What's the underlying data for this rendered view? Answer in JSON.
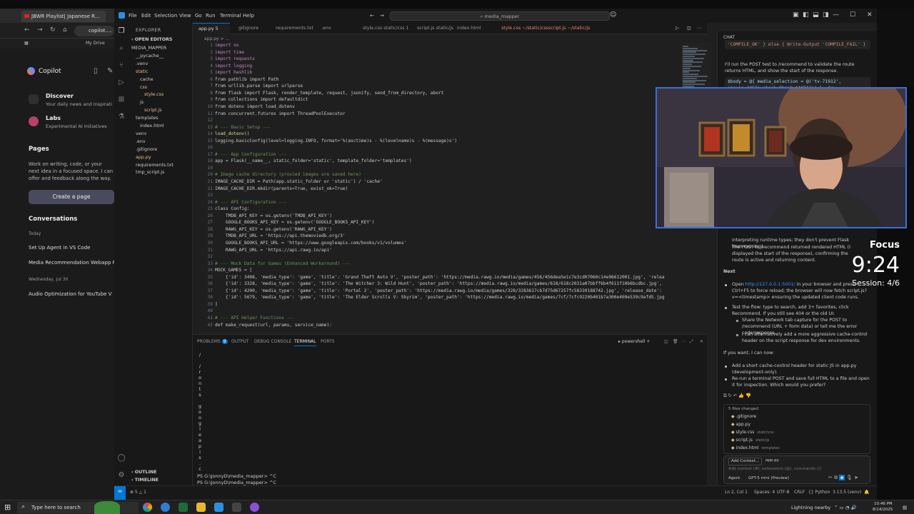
{
  "browser": {
    "tab_title": "JBWR Playlist| Japanese Rhythm",
    "url": "copilot.mic",
    "bookmark": "My Drive"
  },
  "copilot": {
    "brand": "Copilot",
    "discover": "Discover",
    "discover_sub": "Your daily news and inspirati",
    "labs": "Labs",
    "labs_sub": "Experimental AI Initiatives",
    "pages_head": "Pages",
    "pages_text": "Work on writing, code, or your next idea in a focused space. I can offer and feedback along the way.",
    "create_page": "Create a page",
    "conversations": "Conversations",
    "today": "Today",
    "conv1": "Set Up Agent in VS Code",
    "conv2": "Media Recommendation Webapp R",
    "date_head": "Wednesday, Jul 30",
    "conv3": "Audio Optimization for YouTube V"
  },
  "vscode": {
    "menus": [
      "File",
      "Edit",
      "Selection",
      "View",
      "Go",
      "Run",
      "Terminal",
      "Help"
    ],
    "search": "media_mapper",
    "explorer_title": "EXPLORER",
    "open_editors": "OPEN EDITORS",
    "tree": [
      {
        "label": "MEDIA_MAPPER",
        "indent": 0,
        "color": "#ccc"
      },
      {
        "label": "__pycache__",
        "indent": 1,
        "color": "#ccc"
      },
      {
        "label": ".venv",
        "indent": 1,
        "color": "#ccc"
      },
      {
        "label": "static",
        "indent": 1,
        "color": "#e2c08d"
      },
      {
        "label": "cache",
        "indent": 2,
        "color": "#ccc"
      },
      {
        "label": "css",
        "indent": 2,
        "color": "#e2c08d"
      },
      {
        "label": "style.css",
        "indent": 3,
        "color": "#e2c08d"
      },
      {
        "label": "js",
        "indent": 2,
        "color": "#ccc"
      },
      {
        "label": "script.js",
        "indent": 3,
        "color": "#e2c08d"
      },
      {
        "label": "templates",
        "indent": 1,
        "color": "#ccc"
      },
      {
        "label": "index.html",
        "indent": 2,
        "color": "#ccc"
      },
      {
        "label": "venv",
        "indent": 1,
        "color": "#ccc"
      },
      {
        "label": ".env",
        "indent": 1,
        "color": "#ccc"
      },
      {
        "label": ".gitignore",
        "indent": 1,
        "color": "#ccc"
      },
      {
        "label": "app.py",
        "indent": 1,
        "color": "#e2c08d"
      },
      {
        "label": "requirements.txt",
        "indent": 1,
        "color": "#ccc"
      },
      {
        "label": "tmp_script.js",
        "indent": 1,
        "color": "#ccc"
      }
    ],
    "outline": "OUTLINE",
    "timeline": "TIMELINE",
    "tabs": [
      "app.py 5",
      "gitignore",
      "requirements.txt",
      ".env",
      "style.css static/css 1",
      "script.js static/js",
      "index.html",
      "style.css ~/static/css",
      "script.js ~/static/js"
    ],
    "breadcrumb": "app.py > ...",
    "code_lines": [
      [
        "kw",
        "import os"
      ],
      [
        "kw",
        "import time"
      ],
      [
        "kw",
        "import requests"
      ],
      [
        "kw",
        "import logging"
      ],
      [
        "kw",
        "import hashlib"
      ],
      [
        "",
        "from pathlib import Path"
      ],
      [
        "",
        "from urllib.parse import urlparse"
      ],
      [
        "",
        "from flask import Flask, render_template, request, jsonify, send_from_directory, abort"
      ],
      [
        "",
        "from collections import defaultdict"
      ],
      [
        "",
        "from dotenv import load_dotenv"
      ],
      [
        "",
        "from concurrent.futures import ThreadPoolExecutor"
      ],
      [
        "",
        ""
      ],
      [
        "cm",
        "# --- Basic Setup ---"
      ],
      [
        "fn",
        "load_dotenv()"
      ],
      [
        "",
        "logging.basicConfig(level=logging.INFO, format='%(asctime)s - %(levelname)s - %(message)s')"
      ],
      [
        "",
        ""
      ],
      [
        "cm",
        "# --- App Configuration ---"
      ],
      [
        "",
        "app = Flask(__name__, static_folder='static', template_folder='templates')"
      ],
      [
        "",
        ""
      ],
      [
        "cm",
        "# Image cache directory (proxied images are saved here)"
      ],
      [
        "",
        "IMAGE_CACHE_DIR = Path(app.static_folder or 'static') / 'cache'"
      ],
      [
        "",
        "IMAGE_CACHE_DIR.mkdir(parents=True, exist_ok=True)"
      ],
      [
        "",
        ""
      ],
      [
        "cm",
        "# --- API Configuration ---"
      ],
      [
        "",
        "class Config:"
      ],
      [
        "",
        "    TMDB_API_KEY = os.getenv('TMDB_API_KEY')"
      ],
      [
        "",
        "    GOOGLE_BOOKS_API_KEY = os.getenv('GOOGLE_BOOKS_API_KEY')"
      ],
      [
        "",
        "    RAWG_API_KEY = os.getenv('RAWG_API_KEY')"
      ],
      [
        "",
        "    TMDB_API_URL = 'https://api.themoviedb.org/3'"
      ],
      [
        "",
        "    GOOGLE_BOOKS_API_URL = 'https://www.googleapis.com/books/v1/volumes'"
      ],
      [
        "",
        "    RAWG_API_URL = 'https://api.rawg.io/api'"
      ],
      [
        "",
        ""
      ],
      [
        "cm",
        "# --- Mock Data for Games (Enhanced Workaround) ---"
      ],
      [
        "",
        "MOCK_GAMES = ["
      ],
      [
        "",
        "    {'id': 3498, 'media_type': 'game', 'title': 'Grand Theft Auto V', 'poster_path': 'https://media.rawg.io/media/games/456/456dea5e1c7e3cd07060c14e96612001.jpg', 'relea"
      ],
      [
        "",
        "    {'id': 3328, 'media_type': 'game', 'title': 'The Witcher 3: Wild Hunt', 'poster_path': 'https://media.rawg.io/media/games/618/618c2031a07bbff6b4f611f10b6bcdbc.jpg',"
      ],
      [
        "",
        "    {'id': 4200, 'media_type': 'game', 'title': 'Portal 2', 'poster_path': 'https://media.rawg.io/media/games/328/3283617cb7d75d67257fc58339188742.jpg', 'release_date':"
      ],
      [
        "",
        "    {'id': 5679, 'media_type': 'game', 'title': 'The Elder Scrolls V: Skyrim', 'poster_path': 'https://media.rawg.io/media/games/7cf/7cfc9220b401b7a300e409e539c9afd5.jpg"
      ],
      [
        "",
        "]"
      ],
      [
        "",
        ""
      ],
      [
        "cm",
        "# --- API Helper Functions ---"
      ],
      [
        "",
        "def make_request(url, params, service_name):"
      ]
    ],
    "panel_tabs": [
      "PROBLEMS",
      "OUTPUT",
      "DEBUG CONSOLE",
      "TERMINAL",
      "PORTS"
    ],
    "problems_count": "9",
    "shell": "powershell",
    "terminal_vchars": [
      "/",
      "",
      "/",
      "r",
      "o",
      "n",
      "t",
      "s",
      "",
      "g",
      "o",
      "o",
      "g",
      "l",
      "e",
      "a",
      "p",
      "i",
      "s",
      ".",
      "c"
    ],
    "terminal_lines": [
      "PS G:\\JonnyD\\media_mapper> ^C",
      "PS G:\\JonnyD\\media_mapper> ^C",
      "PS G:\\JonnyD\\media_mapper> "
    ],
    "status_left": "⊗ 5 △ 1",
    "status_right": [
      "Ln 2, Col 1",
      "Spaces: 4",
      "UTF-8",
      "CRLF",
      "{} Python",
      "3.13.5 (venv)"
    ]
  },
  "chat": {
    "title": "CHAT",
    "top_code": "'COMPILE_OK' } else { Write-Output 'COMPILE_FAIL' }",
    "p1": "I'll run the POST test to /recommend to validate the route returns HTML, and show the start of the response.",
    "code2a": "$body = @{ media_selection = @('tv-71912',",
    "code2b": "'movie-4457','book-8bpv0wAAQBAJ') }; $r = ",
    "p2a": "interpreting runtime types; they don't prevent Flask from running).",
    "p2b": "The POST to /recommend returned rendered HTML (I displayed the start of the response), confirming the route is active and returning content.",
    "next": "Next",
    "b1a": "Open ",
    "b1link": "http://127.0.0.1:5001/",
    "b1b": " in your browser and press Ctrl+F5 to force reload; the browser will now fetch script.js?v=<timestamp> ensuring the updated client code runs.",
    "b2": "Test the flow: type to search, add 3+ favorites, click Recommend. If you still see 404 or the old UI:",
    "b2s1": "Share the Network tab capture for the POST to /recommend (URL + form data) or tell me the error code/response.",
    "b2s2": "I can alternatively add a more aggressive cache-control header on the script response for dev environments.",
    "p3": "If you want, I can now:",
    "b3": "Add a short cache-control header for static JS in app.py (development-only).",
    "b4": "Re-run a terminal POST and save full HTML to a file and open it for inspection. Which would you prefer?",
    "files_changed": "5 files changed",
    "files": [
      [
        "◆",
        ".gitignore",
        ""
      ],
      [
        "◆",
        "app.py",
        ""
      ],
      [
        "◆",
        "style.css",
        "static\\css"
      ],
      [
        "◆",
        "script.js",
        "static\\js"
      ],
      [
        "◆",
        "index.html",
        "templates"
      ]
    ],
    "add_context": "Add Context...",
    "ctx_file": "app.py",
    "placeholder": "Add context (#), extensions (@), commands (/)",
    "agent": "Agent",
    "model": "GPT-5 mini (Preview)"
  },
  "overlay": {
    "label": "Focus",
    "time": "9:24",
    "session": "Session: 4/6"
  },
  "taskbar": {
    "search": "Type here to search",
    "weather": "Lightning nearby",
    "time": "10:46 PM",
    "date": "8/14/2025"
  }
}
